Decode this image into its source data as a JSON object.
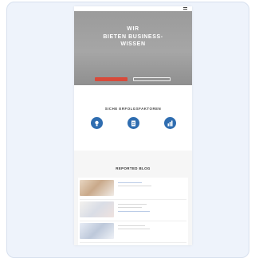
{
  "hero": {
    "title": "WIR\nBIETEN BUSINESS-\nWISSEN",
    "subtitle": "",
    "primary_button": "",
    "secondary_button": ""
  },
  "features": {
    "title": "SICHE ERFOLGSFAKTOREN",
    "items": [
      {
        "icon": "idea-icon",
        "title": "",
        "text": ""
      },
      {
        "icon": "document-icon",
        "title": "",
        "text": ""
      },
      {
        "icon": "chart-icon",
        "title": "",
        "text": ""
      }
    ]
  },
  "blog": {
    "kicker": "",
    "title": "REPORTED BLOG",
    "posts": [
      {
        "meta": "",
        "title": "",
        "image": "office-photo"
      },
      {
        "meta": "",
        "title": "",
        "image": "desk-photo"
      },
      {
        "meta": "",
        "title": "",
        "image": "team-photo"
      }
    ]
  },
  "colors": {
    "accent_button": "#d84a3a",
    "feature_icon": "#2f6db0",
    "hero_bg": "#9b9b9b",
    "card_bg": "#eef3fb"
  }
}
